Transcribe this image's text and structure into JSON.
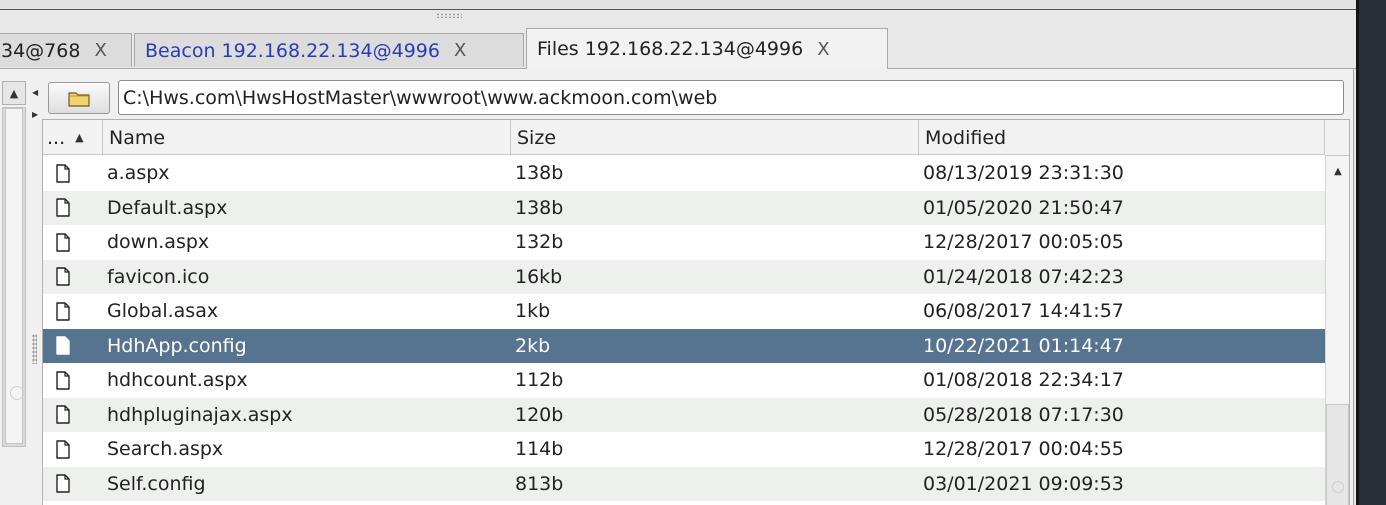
{
  "tabs": [
    {
      "label": "34@768",
      "close": "X"
    },
    {
      "label": "Beacon 192.168.22.134@4996",
      "close": "X"
    },
    {
      "label": "Files 192.168.22.134@4996",
      "close": "X"
    }
  ],
  "path": {
    "value": "C:\\Hws.com\\HwsHostMaster\\wwwroot\\www.ackmoon.com\\web"
  },
  "table": {
    "columns": [
      "...",
      "Name",
      "Size",
      "Modified"
    ],
    "rows": [
      {
        "name": "a.aspx",
        "size": "138b",
        "modified": "08/13/2019 23:31:30"
      },
      {
        "name": "Default.aspx",
        "size": "138b",
        "modified": "01/05/2020 21:50:47"
      },
      {
        "name": "down.aspx",
        "size": "132b",
        "modified": "12/28/2017 00:05:05"
      },
      {
        "name": "favicon.ico",
        "size": "16kb",
        "modified": "01/24/2018 07:42:23"
      },
      {
        "name": "Global.asax",
        "size": "1kb",
        "modified": "06/08/2017 14:41:57"
      },
      {
        "name": "HdhApp.config",
        "size": "2kb",
        "modified": "10/22/2021 01:14:47",
        "selected": true
      },
      {
        "name": "hdhcount.aspx",
        "size": "112b",
        "modified": "01/08/2018 22:34:17"
      },
      {
        "name": "hdhpluginajax.aspx",
        "size": "120b",
        "modified": "05/28/2018 07:17:30"
      },
      {
        "name": "Search.aspx",
        "size": "114b",
        "modified": "12/28/2017 00:04:55"
      },
      {
        "name": "Self.config",
        "size": "813b",
        "modified": "03/01/2021 09:09:53"
      }
    ]
  },
  "icons": {
    "folder": "folder-icon",
    "file": "file-icon",
    "sort": "sort-ascending-icon"
  },
  "colors": {
    "selection": "#56738f",
    "beacon_tab_text": "#2b3bb5",
    "row_alt": "#eef0ee"
  }
}
